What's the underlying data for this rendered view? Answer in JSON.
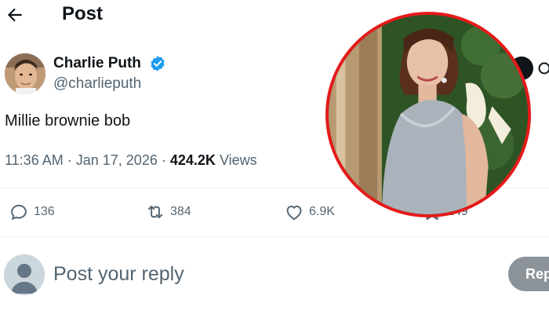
{
  "header": {
    "title": "Post",
    "back_icon": "arrow-left-icon"
  },
  "author": {
    "name": "Charlie Puth",
    "handle": "@charlieputh",
    "verified": true,
    "verified_color": "#1d9bf0"
  },
  "post": {
    "text": "Millie brownie bob",
    "time": "11:36 AM",
    "separator1": "·",
    "date": "Jan 17, 2026",
    "separator2": "·",
    "views_count": "424.2K",
    "views_label": "Views"
  },
  "actions": {
    "replies": {
      "icon": "reply-icon",
      "count": "136"
    },
    "reposts": {
      "icon": "repost-icon",
      "count": "384"
    },
    "likes": {
      "icon": "like-icon",
      "count": "6.9K"
    },
    "bookmarks": {
      "icon": "bookmark-icon",
      "count": "249"
    }
  },
  "reply_box": {
    "placeholder": "Post your reply",
    "button_label": "Reply"
  },
  "colors": {
    "text": "#0f1419",
    "secondary": "#536471",
    "accent": "#1d9bf0",
    "inset_border": "#e51a1a",
    "reply_button": "#8b9298"
  }
}
